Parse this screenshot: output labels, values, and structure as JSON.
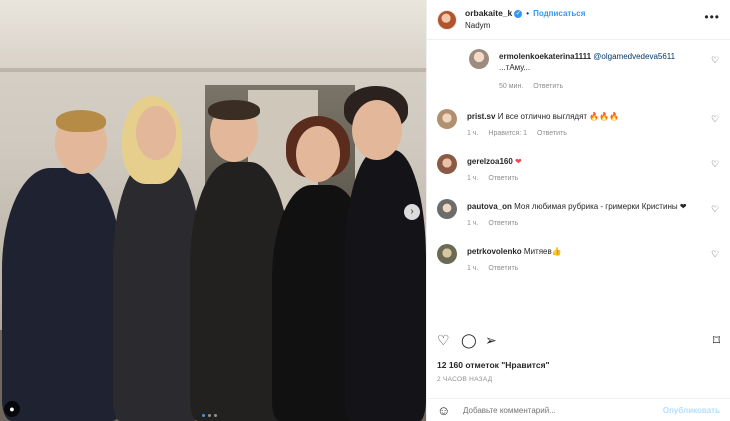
{
  "post": {
    "username": "orbakaite_k",
    "follow_label": "Подписаться",
    "location": "Nadym",
    "photo_alt": "Group photo backstage",
    "slide_count": 3,
    "active_slide": 1
  },
  "comments": [
    {
      "username": "ermolenkoekaterina1111",
      "mention": "@olgamedvedeva5611",
      "text": "...тАму...",
      "time": "50 мин.",
      "likes": "",
      "reply": "Ответить"
    },
    {
      "username": "prist.sv",
      "text": "И все отлично выглядят 🔥🔥🔥",
      "time": "1 ч.",
      "likes": "Нравится: 1",
      "reply": "Ответить"
    },
    {
      "username": "gerelzoa160",
      "text": "❤",
      "time": "1 ч.",
      "likes": "",
      "reply": "Ответить"
    },
    {
      "username": "pautova_on",
      "text": "Моя любимая рубрика - гримерки Кристины ❤",
      "time": "1 ч.",
      "likes": "",
      "reply": "Ответить"
    },
    {
      "username": "petrkovolenko",
      "text": "Митяев👍",
      "time": "1 ч.",
      "likes": "",
      "reply": "Ответить"
    }
  ],
  "likes_text": "12 160 отметок \"Нравится\"",
  "posted_ago": "2 ЧАСОВ НАЗАД",
  "add_comment": {
    "placeholder": "Добавьте комментарий...",
    "publish_label": "Опубликовать"
  },
  "colors": {
    "accent": "#3897f0",
    "muted": "#8e8e8e",
    "disabled_publish": "#b2dffc",
    "heart": "#ed4956"
  }
}
